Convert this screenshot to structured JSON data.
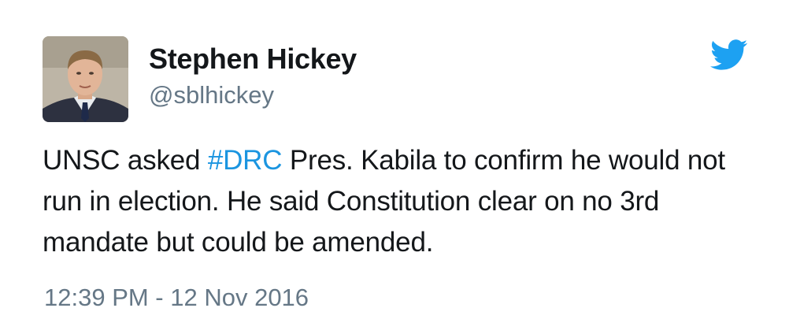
{
  "tweet": {
    "author": {
      "display_name": "Stephen Hickey",
      "handle": "@sblhickey"
    },
    "text_part1": "UNSC asked ",
    "hashtag": "#DRC",
    "text_part2": " Pres. Kabila to confirm he would not run in election. He said Constitution clear on no 3rd mandate but could be amended.",
    "timestamp": "12:39 PM - 12 Nov 2016"
  },
  "icons": {
    "brand": "twitter-bird-icon"
  },
  "colors": {
    "text": "#14171a",
    "secondary": "#657786",
    "link": "#1b95e0",
    "brand": "#1da1f2"
  }
}
